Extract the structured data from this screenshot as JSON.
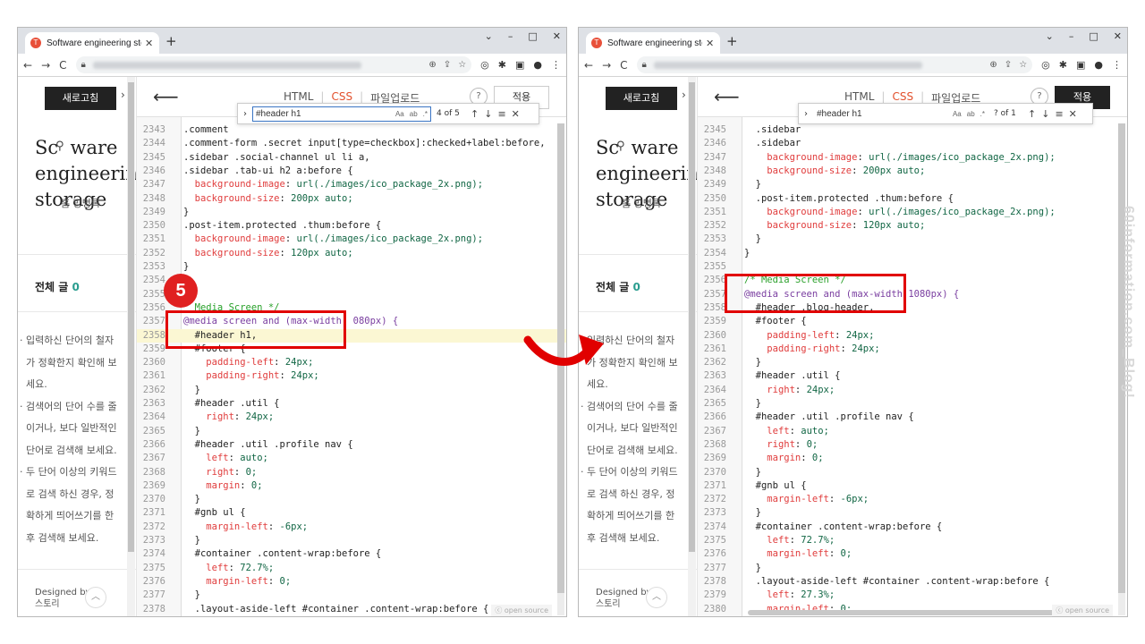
{
  "browser": {
    "tab_title": "Software engineering storage :",
    "new_tab": "+",
    "controls": [
      "⌄",
      "–",
      "□",
      "✕"
    ]
  },
  "blog": {
    "reload_label": "새로고침",
    "title_lines": "Sc  ware\nengineering\nstorage",
    "nav_text": "홈   방명록",
    "count_label": "전체 글",
    "count_value": "0",
    "messages": [
      "· 입력하신 단어의 철자",
      "  가 정확한지 확인해 보",
      "  세요.",
      "· 검색어의 단어 수를 줄",
      "  이거나, 보다 일반적인",
      "  단어로 검색해 보세요.",
      "· 두 단어 이상의 키워드",
      "  로 검색 하신 경우, 정",
      "  확하게 띄어쓰기를 한",
      "  후 검색해 보세요."
    ],
    "footer_line1": "Designed by",
    "footer_line2": "스토리"
  },
  "editor": {
    "tab_html": "HTML",
    "tab_css": "CSS",
    "tab_upload": "파일업로드",
    "help": "?",
    "apply": "적용",
    "open_source": "ⓒ open source"
  },
  "left_find": {
    "query": "#header h1",
    "count": "4 of 5",
    "match_case": "Aa",
    "whole_word": "ab",
    "regex": ".*"
  },
  "right_find": {
    "query": "#header h1",
    "count": "? of 1",
    "match_case": "Aa",
    "whole_word": "ab",
    "regex": ".*"
  },
  "left_code": [
    {
      "n": "2343",
      "t": ".comment"
    },
    {
      "n": "2344",
      "t": ".comment-form .secret input[type=checkbox]:checked+label:before,"
    },
    {
      "n": "2345",
      "t": ".sidebar .social-channel ul li a,"
    },
    {
      "n": "2346",
      "t": ".sidebar .tab-ui h2 a:before {"
    },
    {
      "n": "2347",
      "t": "  background-image: url(./images/ico_package_2x.png);"
    },
    {
      "n": "2348",
      "t": "  background-size: 200px auto;"
    },
    {
      "n": "2349",
      "t": "}"
    },
    {
      "n": "2350",
      "t": ".post-item.protected .thum:before {"
    },
    {
      "n": "2351",
      "t": "  background-image: url(./images/ico_package_2x.png);"
    },
    {
      "n": "2352",
      "t": "  background-size: 120px auto;"
    },
    {
      "n": "2353",
      "t": "}"
    },
    {
      "n": "2354",
      "t": ""
    },
    {
      "n": "2355",
      "t": ""
    },
    {
      "n": "2356",
      "t": "  Media Screen */"
    },
    {
      "n": "2357",
      "t": "@media screen and (max-width: 080px) {"
    },
    {
      "n": "2358",
      "t": "  #header h1,"
    },
    {
      "n": "2359",
      "t": "  #footer {"
    },
    {
      "n": "2360",
      "t": "    padding-left: 24px;"
    },
    {
      "n": "2361",
      "t": "    padding-right: 24px;"
    },
    {
      "n": "2362",
      "t": "  }"
    },
    {
      "n": "2363",
      "t": "  #header .util {"
    },
    {
      "n": "2364",
      "t": "    right: 24px;"
    },
    {
      "n": "2365",
      "t": "  }"
    },
    {
      "n": "2366",
      "t": "  #header .util .profile nav {"
    },
    {
      "n": "2367",
      "t": "    left: auto;"
    },
    {
      "n": "2368",
      "t": "    right: 0;"
    },
    {
      "n": "2369",
      "t": "    margin: 0;"
    },
    {
      "n": "2370",
      "t": "  }"
    },
    {
      "n": "2371",
      "t": "  #gnb ul {"
    },
    {
      "n": "2372",
      "t": "    margin-left: -6px;"
    },
    {
      "n": "2373",
      "t": "  }"
    },
    {
      "n": "2374",
      "t": "  #container .content-wrap:before {"
    },
    {
      "n": "2375",
      "t": "    left: 72.7%;"
    },
    {
      "n": "2376",
      "t": "    margin-left: 0;"
    },
    {
      "n": "2377",
      "t": "  }"
    },
    {
      "n": "2378",
      "t": "  .layout-aside-left #container .content-wrap:before {"
    }
  ],
  "right_code": [
    {
      "n": "2345",
      "t": "  .sidebar"
    },
    {
      "n": "2346",
      "t": "  .sidebar"
    },
    {
      "n": "2347",
      "t": "    background-image: url(./images/ico_package_2x.png);"
    },
    {
      "n": "2348",
      "t": "    background-size: 200px auto;"
    },
    {
      "n": "2349",
      "t": "  }"
    },
    {
      "n": "2350",
      "t": "  .post-item.protected .thum:before {"
    },
    {
      "n": "2351",
      "t": "    background-image: url(./images/ico_package_2x.png);"
    },
    {
      "n": "2352",
      "t": "    background-size: 120px auto;"
    },
    {
      "n": "2353",
      "t": "  }"
    },
    {
      "n": "2354",
      "t": "}"
    },
    {
      "n": "2355",
      "t": ""
    },
    {
      "n": "2356",
      "t": "/* Media Screen */"
    },
    {
      "n": "2357",
      "t": "@media screen and (max-width:1080px) {"
    },
    {
      "n": "2358",
      "t": "  #header .blog-header,"
    },
    {
      "n": "2359",
      "t": "  #footer {"
    },
    {
      "n": "2360",
      "t": "    padding-left: 24px;"
    },
    {
      "n": "2361",
      "t": "    padding-right: 24px;"
    },
    {
      "n": "2362",
      "t": "  }"
    },
    {
      "n": "2363",
      "t": "  #header .util {"
    },
    {
      "n": "2364",
      "t": "    right: 24px;"
    },
    {
      "n": "2365",
      "t": "  }"
    },
    {
      "n": "2366",
      "t": "  #header .util .profile nav {"
    },
    {
      "n": "2367",
      "t": "    left: auto;"
    },
    {
      "n": "2368",
      "t": "    right: 0;"
    },
    {
      "n": "2369",
      "t": "    margin: 0;"
    },
    {
      "n": "2370",
      "t": "  }"
    },
    {
      "n": "2371",
      "t": "  #gnb ul {"
    },
    {
      "n": "2372",
      "t": "    margin-left: -6px;"
    },
    {
      "n": "2373",
      "t": "  }"
    },
    {
      "n": "2374",
      "t": "  #container .content-wrap:before {"
    },
    {
      "n": "2375",
      "t": "    left: 72.7%;"
    },
    {
      "n": "2376",
      "t": "    margin-left: 0;"
    },
    {
      "n": "2377",
      "t": "  }"
    },
    {
      "n": "2378",
      "t": "  .layout-aside-left #container .content-wrap:before {"
    },
    {
      "n": "2379",
      "t": "    left: 27.3%;"
    },
    {
      "n": "2380",
      "t": "    margin-left: 0;"
    },
    {
      "n": "2381",
      "t": "  }"
    }
  ],
  "step_badge": "5",
  "watermark": "60information.com_Blog!",
  "colors": {
    "accent_red": "#e10000",
    "css_tab": "#e2502c"
  }
}
